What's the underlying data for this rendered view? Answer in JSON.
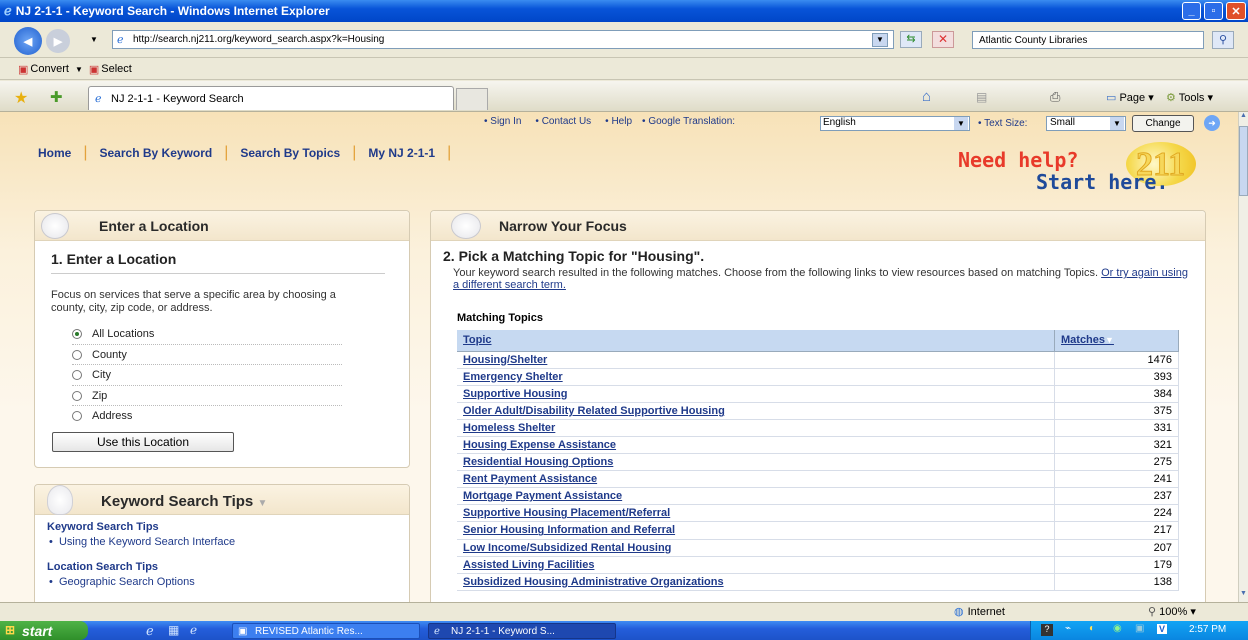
{
  "window": {
    "title": "NJ 2-1-1 - Keyword Search - Windows Internet Explorer"
  },
  "browser": {
    "url": "http://search.nj211.org/keyword_search.aspx?k=Housing",
    "search_provider": "Atlantic County Libraries",
    "links": {
      "convert": "Convert",
      "select": "Select"
    },
    "tab_title": "NJ 2-1-1 - Keyword Search",
    "toolbar": {
      "page": "Page",
      "tools": "Tools"
    }
  },
  "site": {
    "top_links": {
      "sign_in": "Sign In",
      "contact": "Contact Us",
      "help": "Help",
      "translation_label": "Google Translation:",
      "translation_value": "English",
      "text_size_label": "Text Size:",
      "text_size_value": "Small",
      "change": "Change"
    },
    "nav": {
      "home": "Home",
      "keyword": "Search By Keyword",
      "topics": "Search By Topics",
      "my": "My NJ 2-1-1"
    },
    "logo": {
      "line1": "Need help?",
      "line2": "Start here.",
      "number": "211"
    }
  },
  "location_panel": {
    "header": "Enter a Location",
    "step_title": "1. Enter a Location",
    "description": "Focus on services that serve a specific area by choosing a county, city, zip code, or address.",
    "options": [
      "All Locations",
      "County",
      "City",
      "Zip",
      "Address"
    ],
    "selected": "All Locations",
    "button": "Use this Location"
  },
  "tips_panel": {
    "header": "Keyword Search Tips",
    "sections": [
      {
        "title": "Keyword Search Tips",
        "item": "Using the Keyword Search Interface"
      },
      {
        "title": "Location Search Tips",
        "item": "Geographic Search Options"
      }
    ]
  },
  "focus_panel": {
    "header": "Narrow Your Focus",
    "step_title": "2. Pick a Matching Topic for \"Housing\".",
    "description": "Your keyword search resulted in the following matches. Choose from the following links to view resources based on matching Topics.",
    "retry_link": "Or try again using a different search term.",
    "table_caption": "Matching Topics",
    "columns": [
      "Topic",
      "Matches"
    ],
    "rows": [
      {
        "topic": "Housing/Shelter",
        "matches": "1476"
      },
      {
        "topic": "Emergency Shelter",
        "matches": "393"
      },
      {
        "topic": "Supportive Housing",
        "matches": "384"
      },
      {
        "topic": "Older Adult/Disability Related Supportive Housing",
        "matches": "375"
      },
      {
        "topic": "Homeless Shelter",
        "matches": "331"
      },
      {
        "topic": "Housing Expense Assistance",
        "matches": "321"
      },
      {
        "topic": "Residential Housing Options",
        "matches": "275"
      },
      {
        "topic": "Rent Payment Assistance",
        "matches": "241"
      },
      {
        "topic": "Mortgage Payment Assistance",
        "matches": "237"
      },
      {
        "topic": "Supportive Housing Placement/Referral",
        "matches": "224"
      },
      {
        "topic": "Senior Housing Information and Referral",
        "matches": "217"
      },
      {
        "topic": "Low Income/Subsidized Rental Housing",
        "matches": "207"
      },
      {
        "topic": "Assisted Living Facilities",
        "matches": "179"
      },
      {
        "topic": "Subsidized Housing Administrative Organizations",
        "matches": "138"
      }
    ]
  },
  "status": {
    "zone": "Internet",
    "zoom": "100%"
  },
  "taskbar": {
    "start": "start",
    "items": [
      "REVISED Atlantic Res...",
      "NJ 2-1-1 - Keyword S..."
    ],
    "clock": "2:57 PM"
  }
}
